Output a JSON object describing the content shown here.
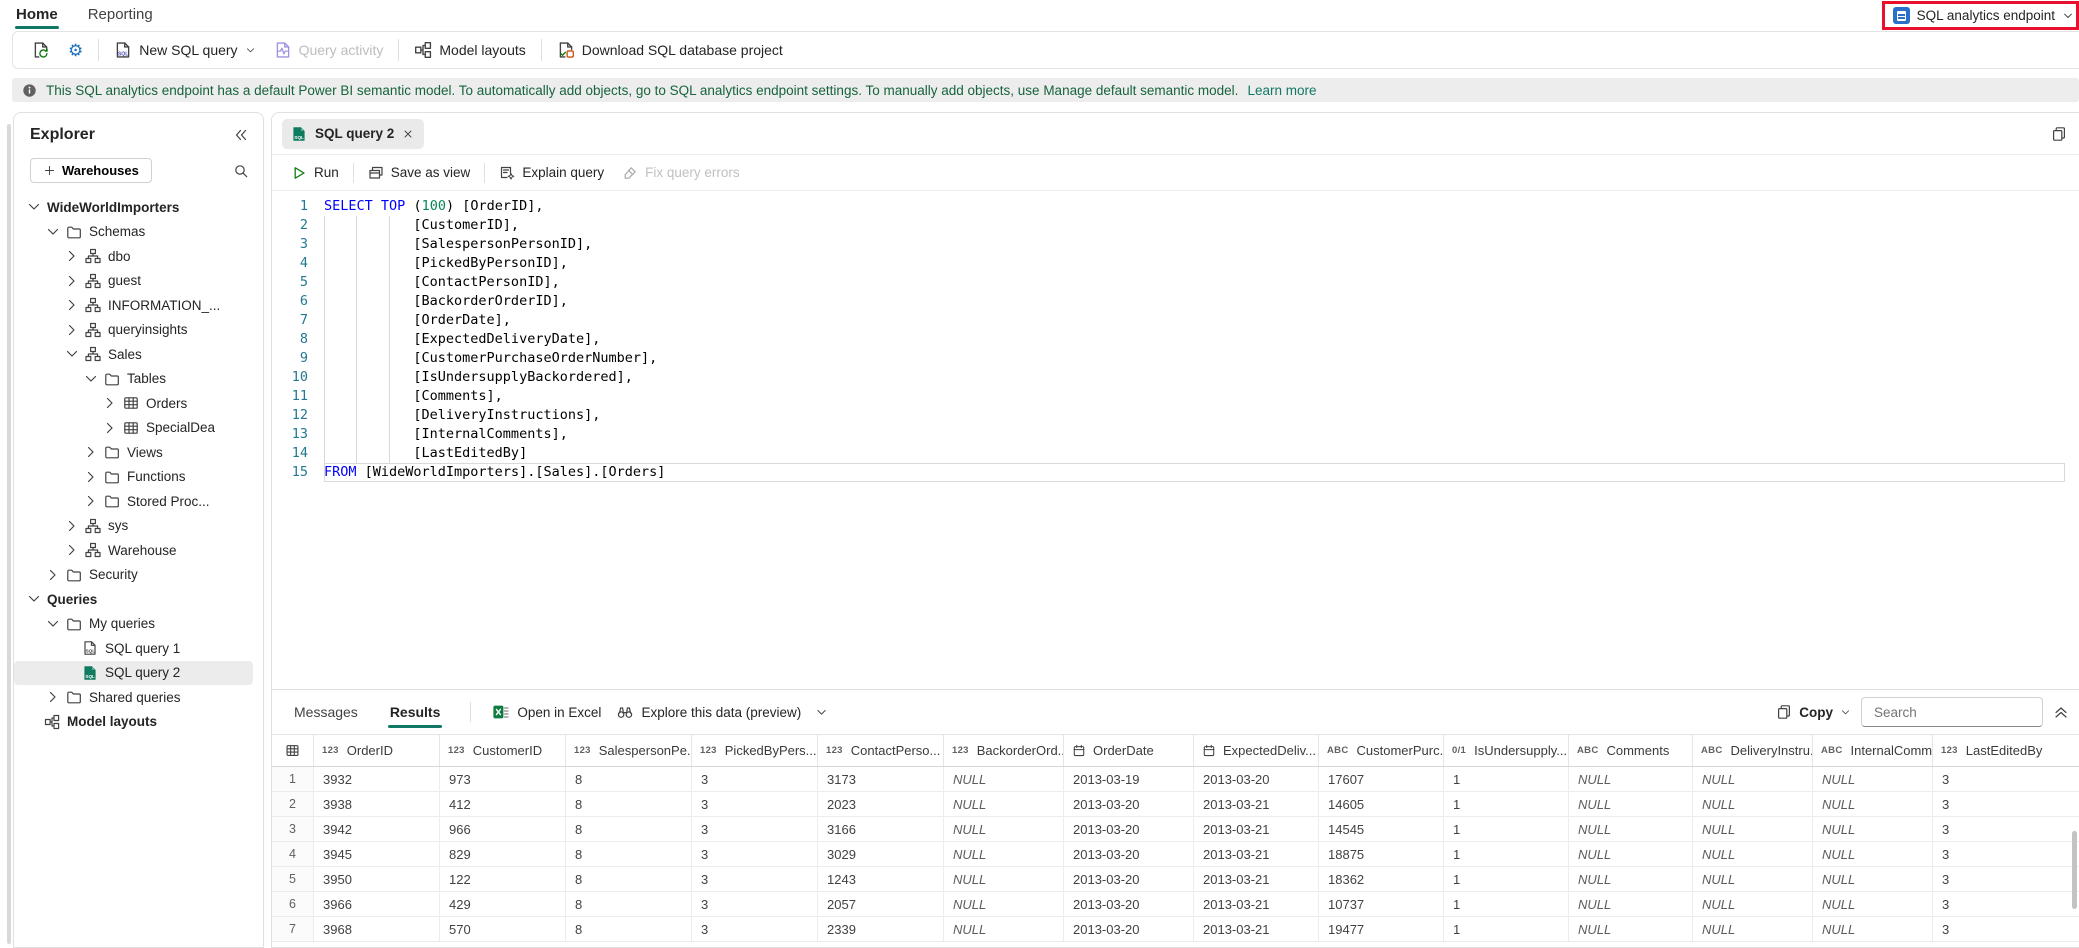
{
  "topbar": {
    "tabs": [
      {
        "label": "Home",
        "active": true
      },
      {
        "label": "Reporting",
        "active": false
      }
    ],
    "endpoint_selector": {
      "label": "SQL analytics endpoint"
    }
  },
  "ribbon": {
    "new_sql_query": "New SQL query",
    "query_activity": "Query activity",
    "model_layouts": "Model layouts",
    "download_project": "Download SQL database project"
  },
  "banner": {
    "text": "This SQL analytics endpoint has a default Power BI semantic model. To automatically add objects, go to SQL analytics endpoint settings. To manually add objects, use Manage default semantic model.",
    "link": "Learn more"
  },
  "explorer": {
    "title": "Explorer",
    "warehouses_button": "Warehouses",
    "tree": [
      {
        "label": "WideWorldImporters",
        "level": 0,
        "chevron": "down",
        "icon": null,
        "bold": true
      },
      {
        "label": "Schemas",
        "level": 1,
        "chevron": "down",
        "icon": "folder",
        "bold": false
      },
      {
        "label": "dbo",
        "level": 2,
        "chevron": "right",
        "icon": "schema",
        "bold": false
      },
      {
        "label": "guest",
        "level": 2,
        "chevron": "right",
        "icon": "schema",
        "bold": false
      },
      {
        "label": "INFORMATION_...",
        "level": 2,
        "chevron": "right",
        "icon": "schema",
        "bold": false
      },
      {
        "label": "queryinsights",
        "level": 2,
        "chevron": "right",
        "icon": "schema",
        "bold": false
      },
      {
        "label": "Sales",
        "level": 2,
        "chevron": "down",
        "icon": "schema",
        "bold": false
      },
      {
        "label": "Tables",
        "level": 3,
        "chevron": "down",
        "icon": "folder",
        "bold": false
      },
      {
        "label": "Orders",
        "level": 4,
        "chevron": "right",
        "icon": "table",
        "bold": false
      },
      {
        "label": "SpecialDea",
        "level": 4,
        "chevron": "right",
        "icon": "table",
        "bold": false
      },
      {
        "label": "Views",
        "level": 3,
        "chevron": "right",
        "icon": "folder",
        "bold": false
      },
      {
        "label": "Functions",
        "level": 3,
        "chevron": "right",
        "icon": "folder",
        "bold": false
      },
      {
        "label": "Stored Proc...",
        "level": 3,
        "chevron": "right",
        "icon": "folder",
        "bold": false
      },
      {
        "label": "sys",
        "level": 2,
        "chevron": "right",
        "icon": "schema",
        "bold": false
      },
      {
        "label": "Warehouse",
        "level": 2,
        "chevron": "right",
        "icon": "schema",
        "bold": false
      },
      {
        "label": "Security",
        "level": 1,
        "chevron": "right",
        "icon": "folder",
        "bold": false
      },
      {
        "label": "Queries",
        "level": 0,
        "chevron": "down",
        "icon": null,
        "bold": true
      },
      {
        "label": "My queries",
        "level": 1,
        "chevron": "down",
        "icon": "folder",
        "bold": false
      },
      {
        "label": "SQL query 1",
        "level": 2,
        "chevron": null,
        "icon": "sql",
        "bold": false
      },
      {
        "label": "SQL query 2",
        "level": 2,
        "chevron": null,
        "icon": "sql-green",
        "bold": false,
        "selected": true
      },
      {
        "label": "Shared queries",
        "level": 1,
        "chevron": "right",
        "icon": "folder",
        "bold": false
      },
      {
        "label": "Model layouts",
        "level": 0,
        "chevron": null,
        "icon": "model",
        "bold": true
      }
    ]
  },
  "query_editor": {
    "tab_title": "SQL query 2",
    "toolbar": {
      "run": "Run",
      "save_as_view": "Save as view",
      "explain_query": "Explain query",
      "fix_query_errors": "Fix query errors"
    },
    "lines": [
      {
        "n": 1,
        "tokens": [
          [
            "kw",
            "SELECT"
          ],
          [
            "pl",
            " "
          ],
          [
            "kw",
            "TOP"
          ],
          [
            "pl",
            " ("
          ],
          [
            "num",
            "100"
          ],
          [
            "pl",
            ") [OrderID],"
          ]
        ]
      },
      {
        "n": 2,
        "tokens": [
          [
            "pl",
            "           [CustomerID],"
          ]
        ]
      },
      {
        "n": 3,
        "tokens": [
          [
            "pl",
            "           [SalespersonPersonID],"
          ]
        ]
      },
      {
        "n": 4,
        "tokens": [
          [
            "pl",
            "           [PickedByPersonID],"
          ]
        ]
      },
      {
        "n": 5,
        "tokens": [
          [
            "pl",
            "           [ContactPersonID],"
          ]
        ]
      },
      {
        "n": 6,
        "tokens": [
          [
            "pl",
            "           [BackorderOrderID],"
          ]
        ]
      },
      {
        "n": 7,
        "tokens": [
          [
            "pl",
            "           [OrderDate],"
          ]
        ]
      },
      {
        "n": 8,
        "tokens": [
          [
            "pl",
            "           [ExpectedDeliveryDate],"
          ]
        ]
      },
      {
        "n": 9,
        "tokens": [
          [
            "pl",
            "           [CustomerPurchaseOrderNumber],"
          ]
        ]
      },
      {
        "n": 10,
        "tokens": [
          [
            "pl",
            "           [IsUndersupplyBackordered],"
          ]
        ]
      },
      {
        "n": 11,
        "tokens": [
          [
            "pl",
            "           [Comments],"
          ]
        ]
      },
      {
        "n": 12,
        "tokens": [
          [
            "pl",
            "           [DeliveryInstructions],"
          ]
        ]
      },
      {
        "n": 13,
        "tokens": [
          [
            "pl",
            "           [InternalComments],"
          ]
        ]
      },
      {
        "n": 14,
        "tokens": [
          [
            "pl",
            "           [LastEditedBy]"
          ]
        ]
      },
      {
        "n": 15,
        "tokens": [
          [
            "kw",
            "FROM"
          ],
          [
            "pl",
            " [WideWorldImporters].[Sales].[Orders]"
          ]
        ]
      }
    ]
  },
  "results": {
    "messages_tab": "Messages",
    "results_tab": "Results",
    "open_in_excel": "Open in Excel",
    "explore": "Explore this data (preview)",
    "copy": "Copy",
    "search_placeholder": "Search",
    "table": {
      "columns": [
        {
          "type": "num",
          "label": "OrderID"
        },
        {
          "type": "num",
          "label": "CustomerID"
        },
        {
          "type": "num",
          "label": "SalespersonPe..."
        },
        {
          "type": "num",
          "label": "PickedByPers..."
        },
        {
          "type": "num",
          "label": "ContactPerso..."
        },
        {
          "type": "num",
          "label": "BackorderOrd..."
        },
        {
          "type": "date",
          "label": "OrderDate"
        },
        {
          "type": "date",
          "label": "ExpectedDeliv..."
        },
        {
          "type": "str",
          "label": "CustomerPurc..."
        },
        {
          "type": "bit",
          "label": "IsUndersupply..."
        },
        {
          "type": "str",
          "label": "Comments"
        },
        {
          "type": "str",
          "label": "DeliveryInstru..."
        },
        {
          "type": "str",
          "label": "InternalComm..."
        },
        {
          "type": "num",
          "label": "LastEditedBy"
        }
      ],
      "rows": [
        [
          "3932",
          "973",
          "8",
          "3",
          "3173",
          "NULL",
          "2013-03-19",
          "2013-03-20",
          "17607",
          "1",
          "NULL",
          "NULL",
          "NULL",
          "3"
        ],
        [
          "3938",
          "412",
          "8",
          "3",
          "2023",
          "NULL",
          "2013-03-20",
          "2013-03-21",
          "14605",
          "1",
          "NULL",
          "NULL",
          "NULL",
          "3"
        ],
        [
          "3942",
          "966",
          "8",
          "3",
          "3166",
          "NULL",
          "2013-03-20",
          "2013-03-21",
          "14545",
          "1",
          "NULL",
          "NULL",
          "NULL",
          "3"
        ],
        [
          "3945",
          "829",
          "8",
          "3",
          "3029",
          "NULL",
          "2013-03-20",
          "2013-03-21",
          "18875",
          "1",
          "NULL",
          "NULL",
          "NULL",
          "3"
        ],
        [
          "3950",
          "122",
          "8",
          "3",
          "1243",
          "NULL",
          "2013-03-20",
          "2013-03-21",
          "18362",
          "1",
          "NULL",
          "NULL",
          "NULL",
          "3"
        ],
        [
          "3966",
          "429",
          "8",
          "3",
          "2057",
          "NULL",
          "2013-03-20",
          "2013-03-21",
          "10737",
          "1",
          "NULL",
          "NULL",
          "NULL",
          "3"
        ],
        [
          "3968",
          "570",
          "8",
          "3",
          "2339",
          "NULL",
          "2013-03-20",
          "2013-03-21",
          "19477",
          "1",
          "NULL",
          "NULL",
          "NULL",
          "3"
        ]
      ]
    }
  }
}
